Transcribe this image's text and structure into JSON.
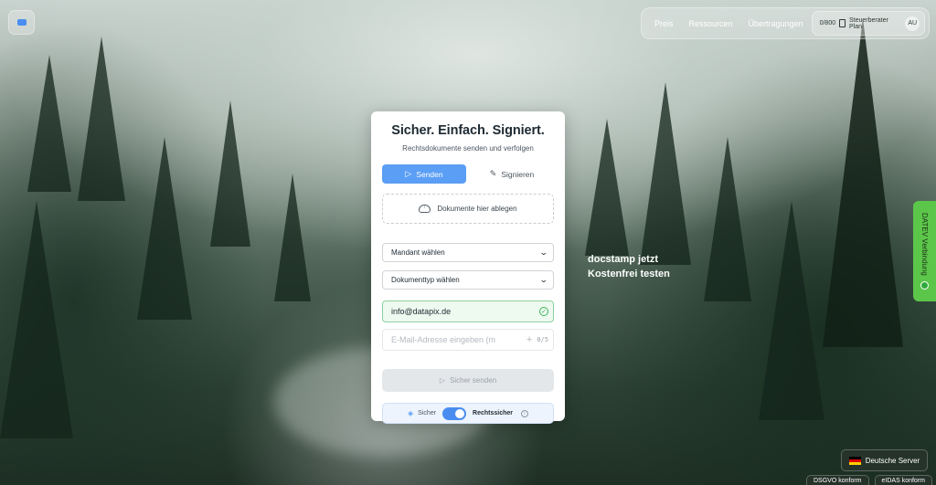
{
  "nav": {
    "links": [
      "Preis",
      "Ressourcen",
      "Übertragungen"
    ],
    "plan": {
      "count": "0/800",
      "name": "Steuerberater Plan",
      "avatar": "AU"
    }
  },
  "card": {
    "title": "Sicher. Einfach. Signiert.",
    "subtitle": "Rechtsdokumente senden und verfolgen",
    "tabs": [
      {
        "label": "Senden",
        "icon": "send-icon",
        "active": true
      },
      {
        "label": "Signieren",
        "icon": "pen-icon",
        "active": false
      }
    ],
    "dropzone_label": "Dokumente hier ablegen",
    "client_select": "Mandant wählen",
    "doctype_select": "Dokumenttyp wählen",
    "recipient_email": "info@datapix.de",
    "email_placeholder": "E-Mail-Adresse eingeben (m",
    "email_count": "0/5",
    "send_label": "Sicher senden",
    "mode_left": "Sicher",
    "mode_right": "Rechtssicher",
    "mode_toggle_on": true
  },
  "promo": {
    "line1": "docstamp jetzt",
    "line2": "Kostenfrei testen"
  },
  "datev": {
    "label": "DATEV Verbindung",
    "status_color": "#2ea83c"
  },
  "server": {
    "label": "Deutsche Server"
  },
  "badges": [
    "DSGVO konform",
    "eIDAS konform"
  ],
  "colors": {
    "accent": "#5b9ef5",
    "success": "#3fb45a",
    "datev_green": "#5cc64a"
  }
}
